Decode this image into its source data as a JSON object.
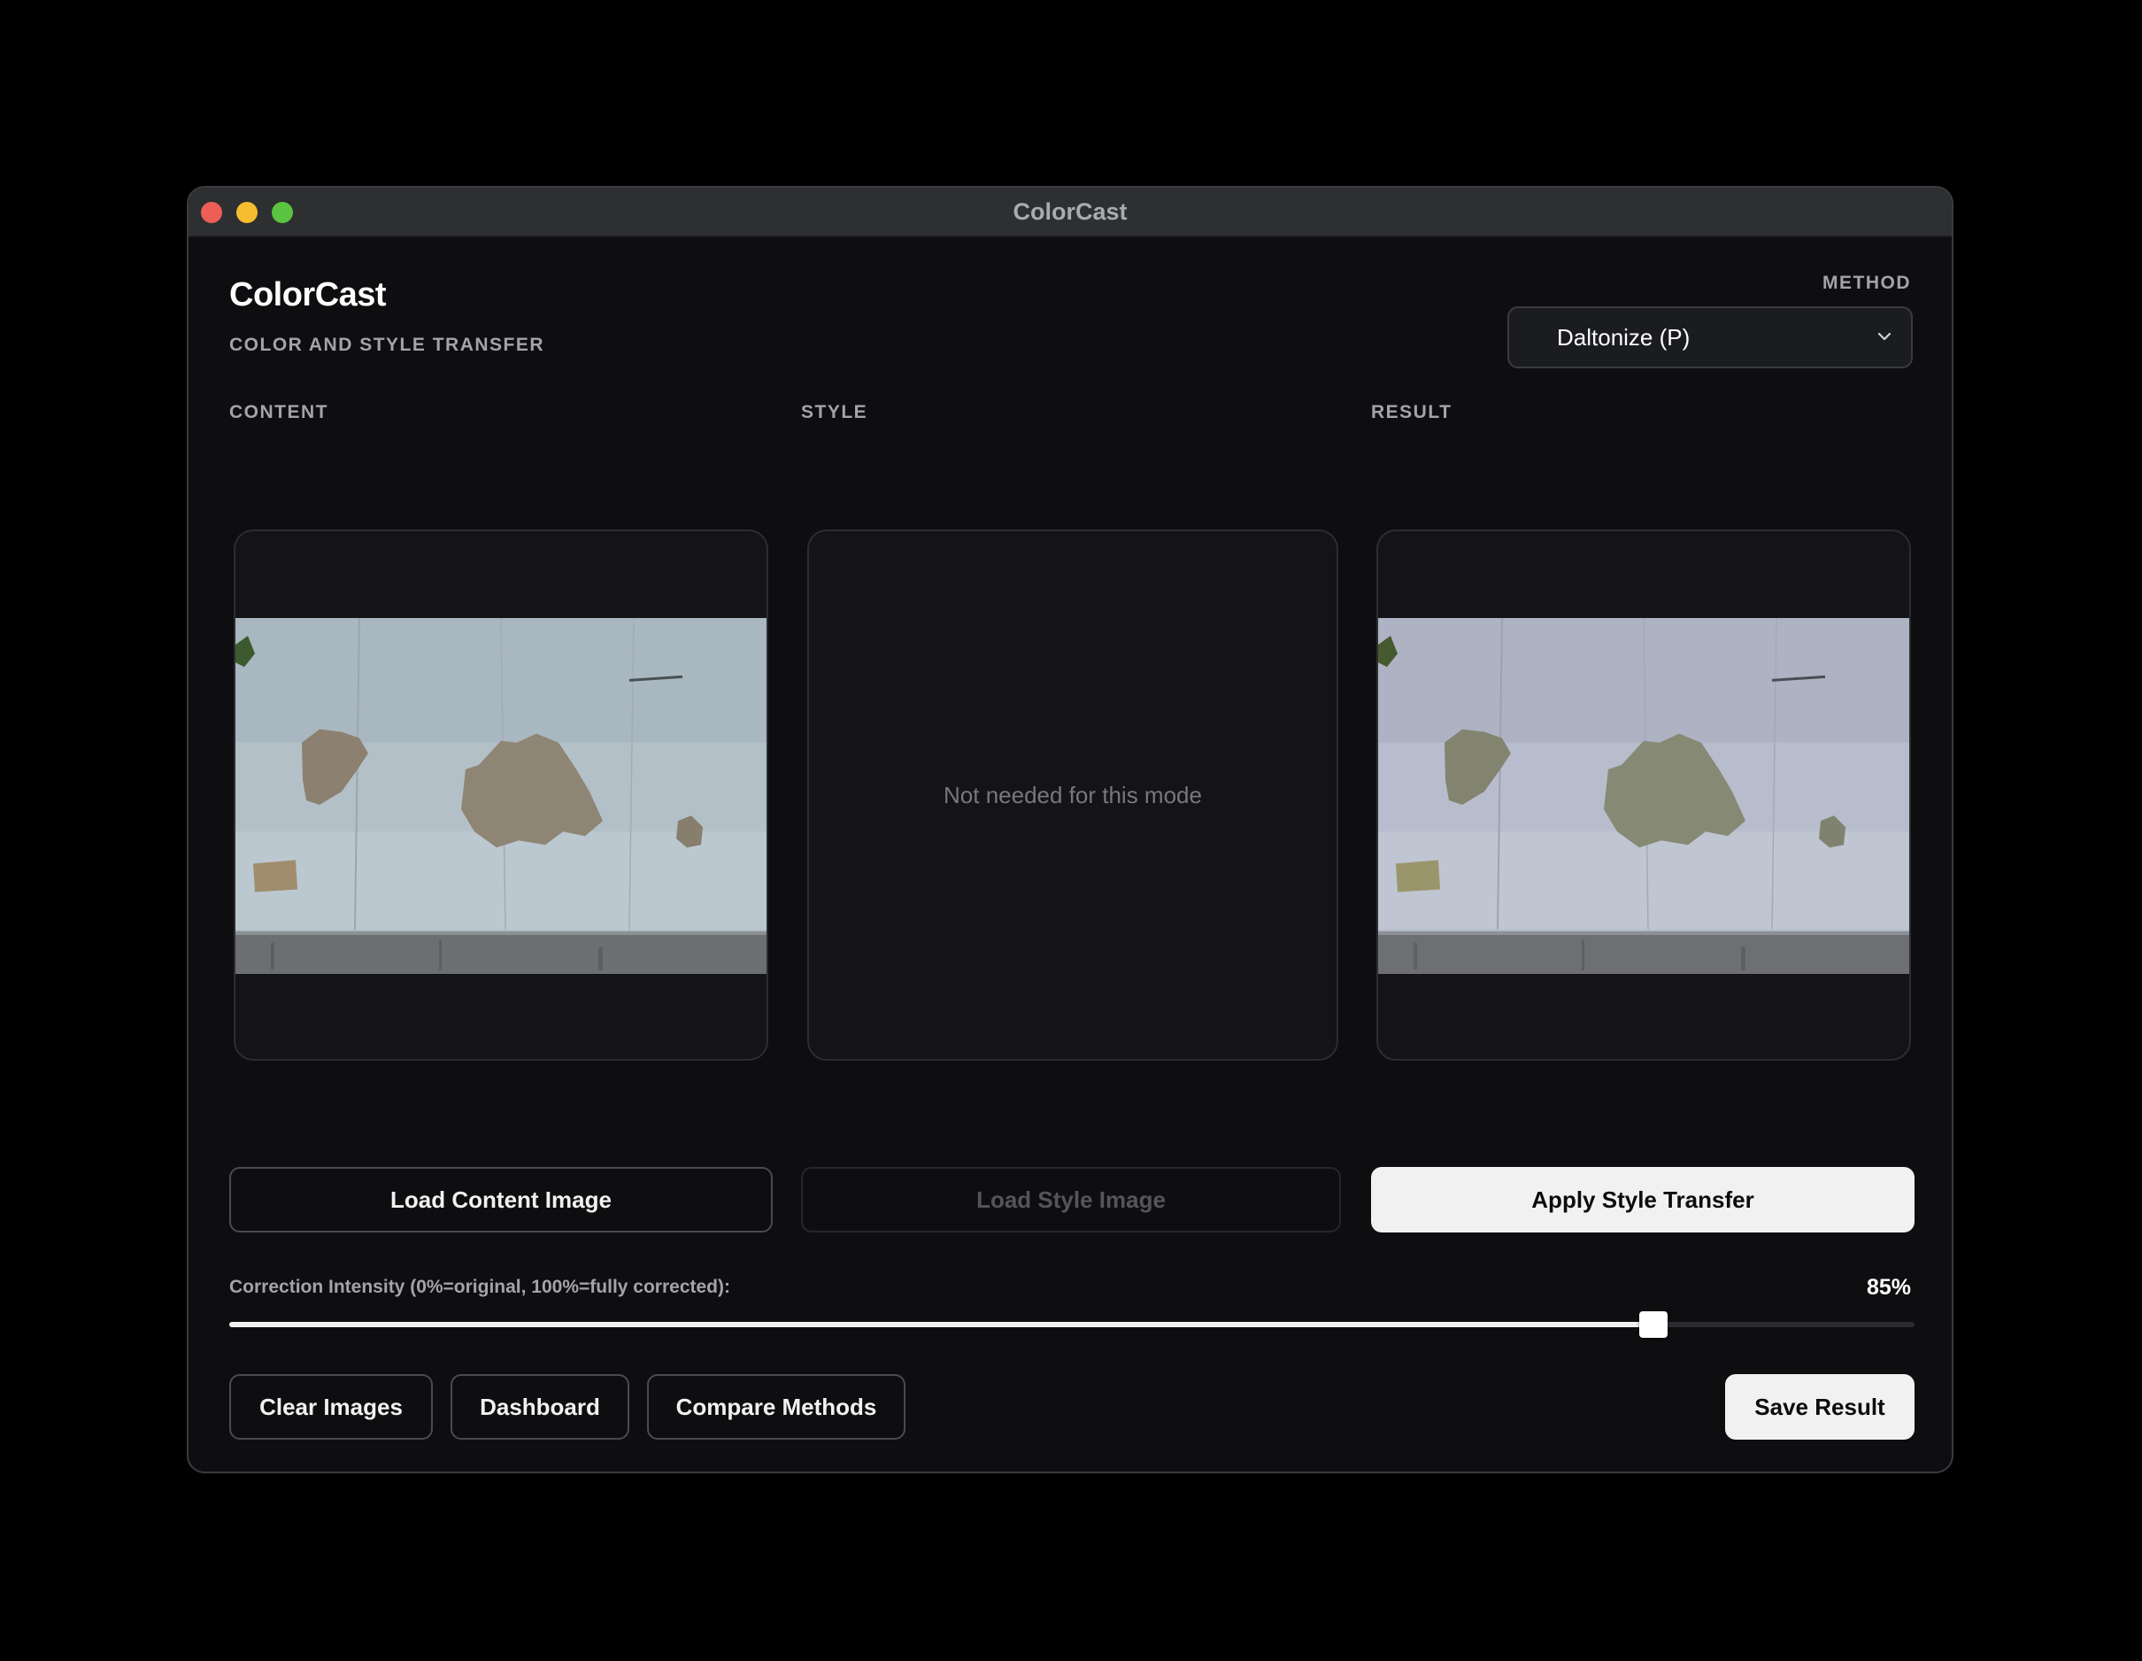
{
  "window": {
    "title": "ColorCast"
  },
  "header": {
    "app_title": "ColorCast",
    "subtitle": "COLOR AND STYLE TRANSFER"
  },
  "method": {
    "label": "METHOD",
    "selected": "Daltonize (P)"
  },
  "columns": {
    "content": {
      "label": "CONTENT"
    },
    "style": {
      "label": "STYLE",
      "placeholder": "Not needed for this mode"
    },
    "result": {
      "label": "RESULT"
    }
  },
  "actions": {
    "load_content": "Load Content Image",
    "load_style": "Load Style Image",
    "apply": "Apply Style Transfer"
  },
  "intensity": {
    "label": "Correction Intensity (0%=original, 100%=fully corrected):",
    "value_text": "85%",
    "value": 0.845
  },
  "footer": {
    "clear": "Clear Images",
    "dashboard": "Dashboard",
    "compare": "Compare Methods",
    "save": "Save Result"
  },
  "icons": {
    "dropdown": "chevron-down-icon"
  },
  "colors": {
    "close": "#ed5f56",
    "minimize": "#f5bd2f",
    "maximize": "#5ac33f",
    "primary_button": "#f1f1f1"
  }
}
